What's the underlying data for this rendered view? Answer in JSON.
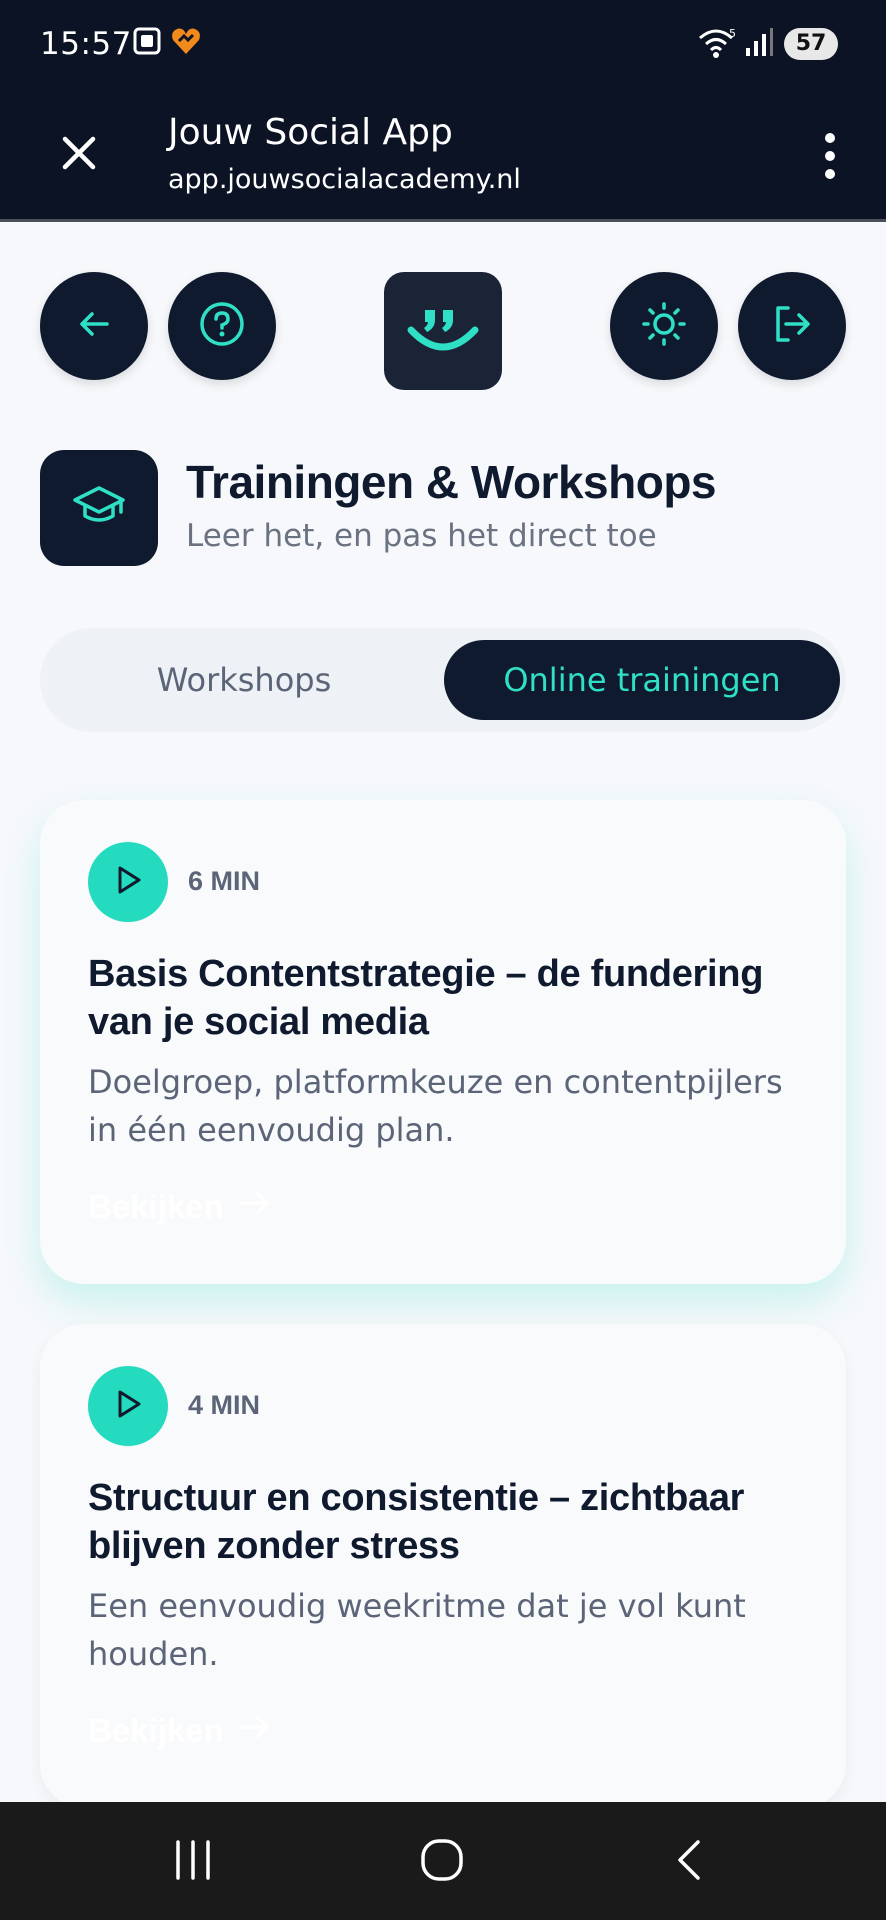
{
  "status_bar": {
    "time": "15:57",
    "battery": "57",
    "icons": [
      "screenshot-icon",
      "heart-icon",
      "wifi-icon",
      "signal-icon"
    ]
  },
  "browser": {
    "title": "Jouw Social App",
    "url": "app.jouwsocialacademy.nl"
  },
  "header": {
    "title": "Trainingen & Workshops",
    "subtitle": "Leer het, en pas het direct toe"
  },
  "tabs": [
    {
      "label": "Workshops",
      "active": false
    },
    {
      "label": "Online trainingen",
      "active": true
    }
  ],
  "trainings": [
    {
      "duration": "6 MIN",
      "title": "Basis Contentstrategie – de fundering van je social media",
      "description": "Doelgroep, platformkeuze en contentpijlers in één eenvoudig plan.",
      "cta": "Bekijken"
    },
    {
      "duration": "4 MIN",
      "title": "Structuur en consistentie – zichtbaar blijven zonder stress",
      "description": "Een eenvoudig weekritme dat je vol kunt houden.",
      "cta": "Bekijken"
    }
  ],
  "colors": {
    "dark": "#0f1a2e",
    "accent": "#2fe0c6",
    "play": "#24dbbf"
  }
}
